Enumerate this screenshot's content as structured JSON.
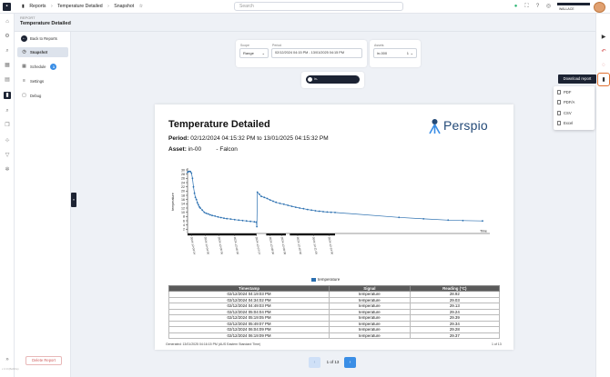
{
  "topbar": {
    "breadcrumbs": [
      "Reports",
      "Temperature Detailed",
      "Snapshot"
    ],
    "search_placeholder": "Search",
    "user_name": "WALLACE"
  },
  "report": {
    "kicker": "REPORT",
    "title": "Temperature Detailed"
  },
  "subnav": {
    "back_label": "Back to Reports",
    "items": [
      {
        "label": "Snapshot",
        "icon": "clock-icon"
      },
      {
        "label": "Schedule",
        "icon": "calendar-icon",
        "badge": "1"
      },
      {
        "label": "Settings",
        "icon": "sliders-icon"
      },
      {
        "label": "Debug",
        "icon": "bug-icon"
      }
    ],
    "delete_label": "Delete Report",
    "version": "v 2.0 (8e0f2e)"
  },
  "filters": {
    "scope_label": "Scope",
    "scope_value": "Range",
    "period_label": "Period",
    "period_value": "02/12/2024 04:15 PM - 13/01/2025 04:15 PM",
    "assets_label": "Assets",
    "assets_value": "in-000",
    "assets_count": "1"
  },
  "asset_chip": {
    "label": "in-"
  },
  "document": {
    "title": "Temperature Detailed",
    "period_label": "Period:",
    "period_value": "02/12/2024 04:15:32 PM to 13/01/2025 04:15:32 PM",
    "asset_label": "Asset:",
    "asset_value": "in-00",
    "asset_name": "- Falcon",
    "brand": "Perspio",
    "table_headers": [
      "Timestamp",
      "Signal",
      "Reading (°C)"
    ],
    "table_rows": [
      [
        "02/12/2024 04:19:03 PM",
        "temperature",
        "28.92"
      ],
      [
        "02/12/2024 04:34:02 PM",
        "temperature",
        "29.03"
      ],
      [
        "02/12/2024 04:49:03 PM",
        "temperature",
        "29.13"
      ],
      [
        "02/12/2024 05:04:04 PM",
        "temperature",
        "29.24"
      ],
      [
        "02/12/2024 05:19:05 PM",
        "temperature",
        "29.39"
      ],
      [
        "02/12/2024 05:49:07 PM",
        "temperature",
        "29.34"
      ],
      [
        "02/12/2024 06:04:09 PM",
        "temperature",
        "29.28"
      ],
      [
        "02/12/2024 06:19:09 PM",
        "temperature",
        "29.37"
      ]
    ],
    "footer": "Generated: 13/01/2025 04:16:15 PM (AUS Eastern Standard Time)",
    "page": "1 of 13"
  },
  "pagination": {
    "text": "1 of 13",
    "prev": "‹",
    "next": "›"
  },
  "right_rail": {
    "tooltip": "Download report",
    "menu": [
      "PDF",
      "PDF/A",
      "CSV",
      "Excel"
    ]
  },
  "chart_data": {
    "type": "line",
    "title": "",
    "xlabel": "Time",
    "ylabel": "temperature",
    "ylim": [
      0,
      30
    ],
    "yticks": [
      2,
      4,
      6,
      8,
      10,
      12,
      14,
      16,
      18,
      20,
      22,
      24,
      26,
      28,
      30
    ],
    "legend": [
      "temperature"
    ],
    "legend_position": "bottom",
    "series": [
      {
        "name": "temperature",
        "color": "#2a6fb0",
        "x": [
          0,
          1,
          2,
          3,
          4,
          5,
          6,
          7,
          8,
          9,
          10,
          11,
          12,
          13,
          15,
          17,
          19,
          21,
          23,
          25,
          28,
          31,
          34,
          37,
          40,
          44,
          48,
          52,
          56,
          60,
          64,
          68,
          70,
          70.5,
          71,
          73,
          75,
          78,
          81,
          84,
          87,
          90,
          94,
          98,
          102,
          106,
          110,
          114,
          118,
          122,
          126,
          130,
          134,
          138,
          142,
          146,
          150,
          215,
          240,
          265,
          280,
          300
        ],
        "y": [
          28.9,
          29.2,
          29.3,
          29.2,
          28.5,
          26,
          22,
          19,
          17,
          16,
          14.5,
          13.5,
          12.5,
          12,
          11,
          10,
          9.5,
          9.2,
          8.8,
          8.5,
          8.2,
          7.8,
          7.5,
          7.2,
          7,
          6.8,
          6.5,
          6.3,
          6.1,
          5.9,
          5.7,
          5.5,
          5.4,
          3.2,
          19.5,
          18.5,
          17.5,
          17,
          16.5,
          15.8,
          15.2,
          14.7,
          14.2,
          13.8,
          13.3,
          12.8,
          12.4,
          12,
          11.7,
          11.3,
          11,
          10.7,
          10.5,
          10.3,
          10.1,
          10,
          9.9,
          7.6,
          6.9,
          6.3,
          6.1,
          5.9
        ]
      }
    ],
    "x_tick_labels": [
      "2024-12-03 04",
      "2024-12-04 00",
      "2024-12-05 06",
      "2024-12-06 00",
      "2024-12-07 07",
      "2024-12-08 00",
      "2024-12-09 08",
      "2024-12-10 00",
      "2024-12-11 09",
      "2024-12-12 00"
    ]
  }
}
